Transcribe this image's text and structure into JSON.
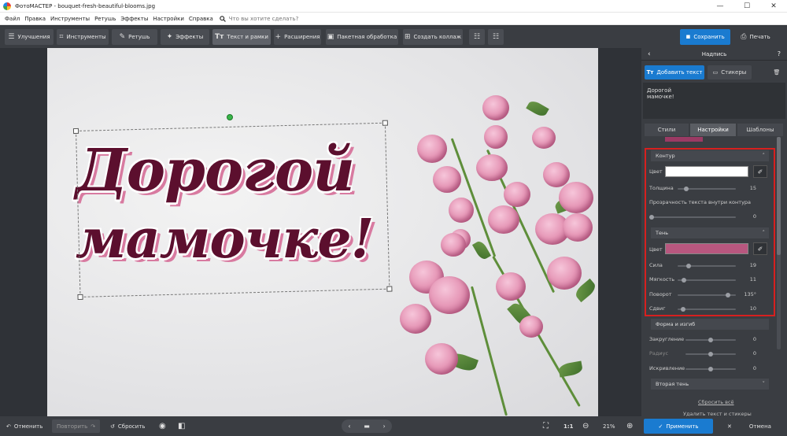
{
  "window": {
    "title": "ФотоМАСТЕР - bouquet-fresh-beautiful-blooms.jpg",
    "minimize_glyph": "—",
    "maximize_glyph": "☐",
    "close_glyph": "✕"
  },
  "menu": {
    "items": [
      "Файл",
      "Правка",
      "Инструменты",
      "Ретушь",
      "Эффекты",
      "Настройки",
      "Справка"
    ],
    "search_placeholder": "Что вы хотите сделать?"
  },
  "toolbar": {
    "tabs": [
      {
        "label": "Улучшения",
        "icon": "sliders-icon"
      },
      {
        "label": "Инструменты",
        "icon": "crop-icon"
      },
      {
        "label": "Ретушь",
        "icon": "brush-icon"
      },
      {
        "label": "Эффекты",
        "icon": "magic-wand-icon"
      },
      {
        "label": "Текст и рамки",
        "icon": "text-icon",
        "active": true
      },
      {
        "label": "Расширения",
        "icon": "plus-icon"
      }
    ],
    "batch_label": "Пакетная обработка",
    "collage_label": "Создать коллаж",
    "save_label": "Сохранить",
    "print_label": "Печать",
    "accent_color": "#1a7bd0"
  },
  "canvas": {
    "line1": "Дорогой",
    "line2": "мамочке!",
    "text_color": "#5c0f2e",
    "shadow_color": "#d87aa0"
  },
  "bottom": {
    "undo_label": "Отменить",
    "redo_label": "Повторить",
    "reset_label": "Сбросить",
    "ratio_label": "1:1",
    "zoom_label": "21%",
    "apply_label": "Применить",
    "cancel_label": "Отмена"
  },
  "panel": {
    "title": "Надпись",
    "add_text_label": "Добавить текст",
    "stickers_label": "Стикеры",
    "text_preview": [
      "Дорогой",
      "мамочке!"
    ],
    "tabs": [
      "Стили",
      "Настройки",
      "Шаблоны"
    ],
    "active_tab": "Настройки",
    "contour": {
      "header": "Контур",
      "color_label": "Цвет",
      "color": "#ffffff",
      "thickness_label": "Толщина",
      "thickness_value": "15",
      "thickness_fraction": 0.15,
      "inner_opacity_label": "Прозрачность текста внутри контура",
      "inner_opacity_value": "0",
      "inner_opacity_fraction": 0.0
    },
    "shadow": {
      "header": "Тень",
      "color_label": "Цвет",
      "color": "#b8577f",
      "rows": [
        {
          "label": "Сила",
          "value": "19",
          "fraction": 0.19
        },
        {
          "label": "Мягкость",
          "value": "11",
          "fraction": 0.11
        },
        {
          "label": "Поворот",
          "value": "135°",
          "fraction": 0.86
        },
        {
          "label": "Сдвиг",
          "value": "10",
          "fraction": 0.1
        }
      ]
    },
    "shape": {
      "header": "Форма и изгиб",
      "rows": [
        {
          "label": "Закругление",
          "value": "0",
          "fraction": 0.5,
          "dim": false
        },
        {
          "label": "Радиус",
          "value": "0",
          "fraction": 0.5,
          "dim": true
        },
        {
          "label": "Искривление",
          "value": "0",
          "fraction": 0.5,
          "dim": false
        }
      ]
    },
    "second_shadow_header": "Вторая тень",
    "reset_all_link": "Сбросить всё",
    "delete_link": "Удалить текст и стикеры"
  }
}
